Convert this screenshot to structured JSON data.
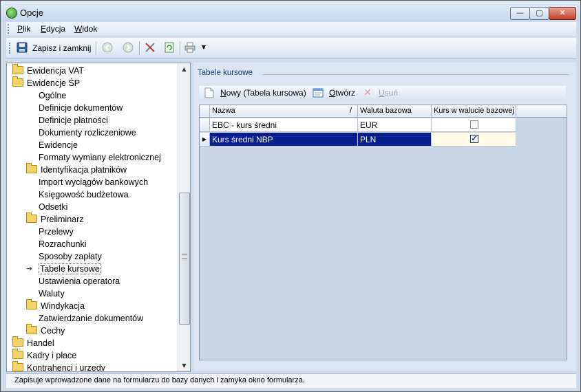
{
  "window": {
    "title": "Opcje",
    "min_label": "—",
    "max_label": "▢",
    "close_label": "✕"
  },
  "menu": {
    "items": [
      "Plik",
      "Edycja",
      "Widok"
    ]
  },
  "toolbar": {
    "save_close_label": "Zapisz i zamknij"
  },
  "tree": {
    "items": [
      {
        "label": "Ewidencja VAT",
        "level": 0,
        "folder": true
      },
      {
        "label": "Ewidencje ŚP",
        "level": 0,
        "folder": true
      },
      {
        "label": "Ogólne",
        "level": 1,
        "folder": false
      },
      {
        "label": "Definicje dokumentów",
        "level": 1,
        "folder": false
      },
      {
        "label": "Definicje płatności",
        "level": 1,
        "folder": false
      },
      {
        "label": "Dokumenty rozliczeniowe",
        "level": 1,
        "folder": false
      },
      {
        "label": "Ewidencje",
        "level": 1,
        "folder": false
      },
      {
        "label": "Formaty wymiany elektronicznej",
        "level": 1,
        "folder": false
      },
      {
        "label": "Identyfikacja płatników",
        "level": 1,
        "folder": true
      },
      {
        "label": "Import wyciągów bankowych",
        "level": 1,
        "folder": false
      },
      {
        "label": "Księgowość budżetowa",
        "level": 1,
        "folder": false
      },
      {
        "label": "Odsetki",
        "level": 1,
        "folder": false
      },
      {
        "label": "Preliminarz",
        "level": 1,
        "folder": true
      },
      {
        "label": "Przelewy",
        "level": 1,
        "folder": false
      },
      {
        "label": "Rozrachunki",
        "level": 1,
        "folder": false
      },
      {
        "label": "Sposoby zapłaty",
        "level": 1,
        "folder": false
      },
      {
        "label": "Tabele kursowe",
        "level": 1,
        "folder": false,
        "current": true
      },
      {
        "label": "Ustawienia operatora",
        "level": 1,
        "folder": false
      },
      {
        "label": "Waluty",
        "level": 1,
        "folder": false
      },
      {
        "label": "Windykacja",
        "level": 1,
        "folder": true
      },
      {
        "label": "Zatwierdzanie dokumentów",
        "level": 1,
        "folder": false
      },
      {
        "label": "Cechy",
        "level": 1,
        "folder": true
      },
      {
        "label": "Handel",
        "level": 0,
        "folder": true
      },
      {
        "label": "Kadry i płace",
        "level": 0,
        "folder": true
      },
      {
        "label": "Kontrahenci i urzędy",
        "level": 0,
        "folder": true
      }
    ]
  },
  "section": {
    "title": "Tabele kursowe"
  },
  "content_toolbar": {
    "new_label": "Nowy (Tabela kursowa)",
    "open_label": "Otwórz",
    "delete_label": "Usuń"
  },
  "grid": {
    "columns": [
      "Nazwa",
      "Waluta bazowa",
      "Kurs w walucie bazowej"
    ],
    "sort_marker": "/",
    "rows": [
      {
        "name": "EBC - kurs średni",
        "currency": "EUR",
        "checked": false,
        "selected": false
      },
      {
        "name": "Kurs średni NBP",
        "currency": "PLN",
        "checked": true,
        "selected": true
      }
    ]
  },
  "status": {
    "text": "Zapisuje wprowadzone dane na formularzu do bazy danych i zamyka okno formularza."
  },
  "icons": {
    "app": "app-icon",
    "save": "floppy-disk-icon",
    "back": "back-arrow-icon",
    "forward": "forward-arrow-icon",
    "tools": "tools-icon",
    "refresh": "refresh-icon",
    "print": "printer-icon",
    "dropdown": "chevron-down-icon",
    "new": "new-document-icon",
    "open": "open-document-icon",
    "delete": "delete-x-icon",
    "folder": "folder-icon",
    "current": "current-item-arrow-icon"
  },
  "colors": {
    "selection": "#0a1f8f",
    "section_title": "#173e7f"
  }
}
